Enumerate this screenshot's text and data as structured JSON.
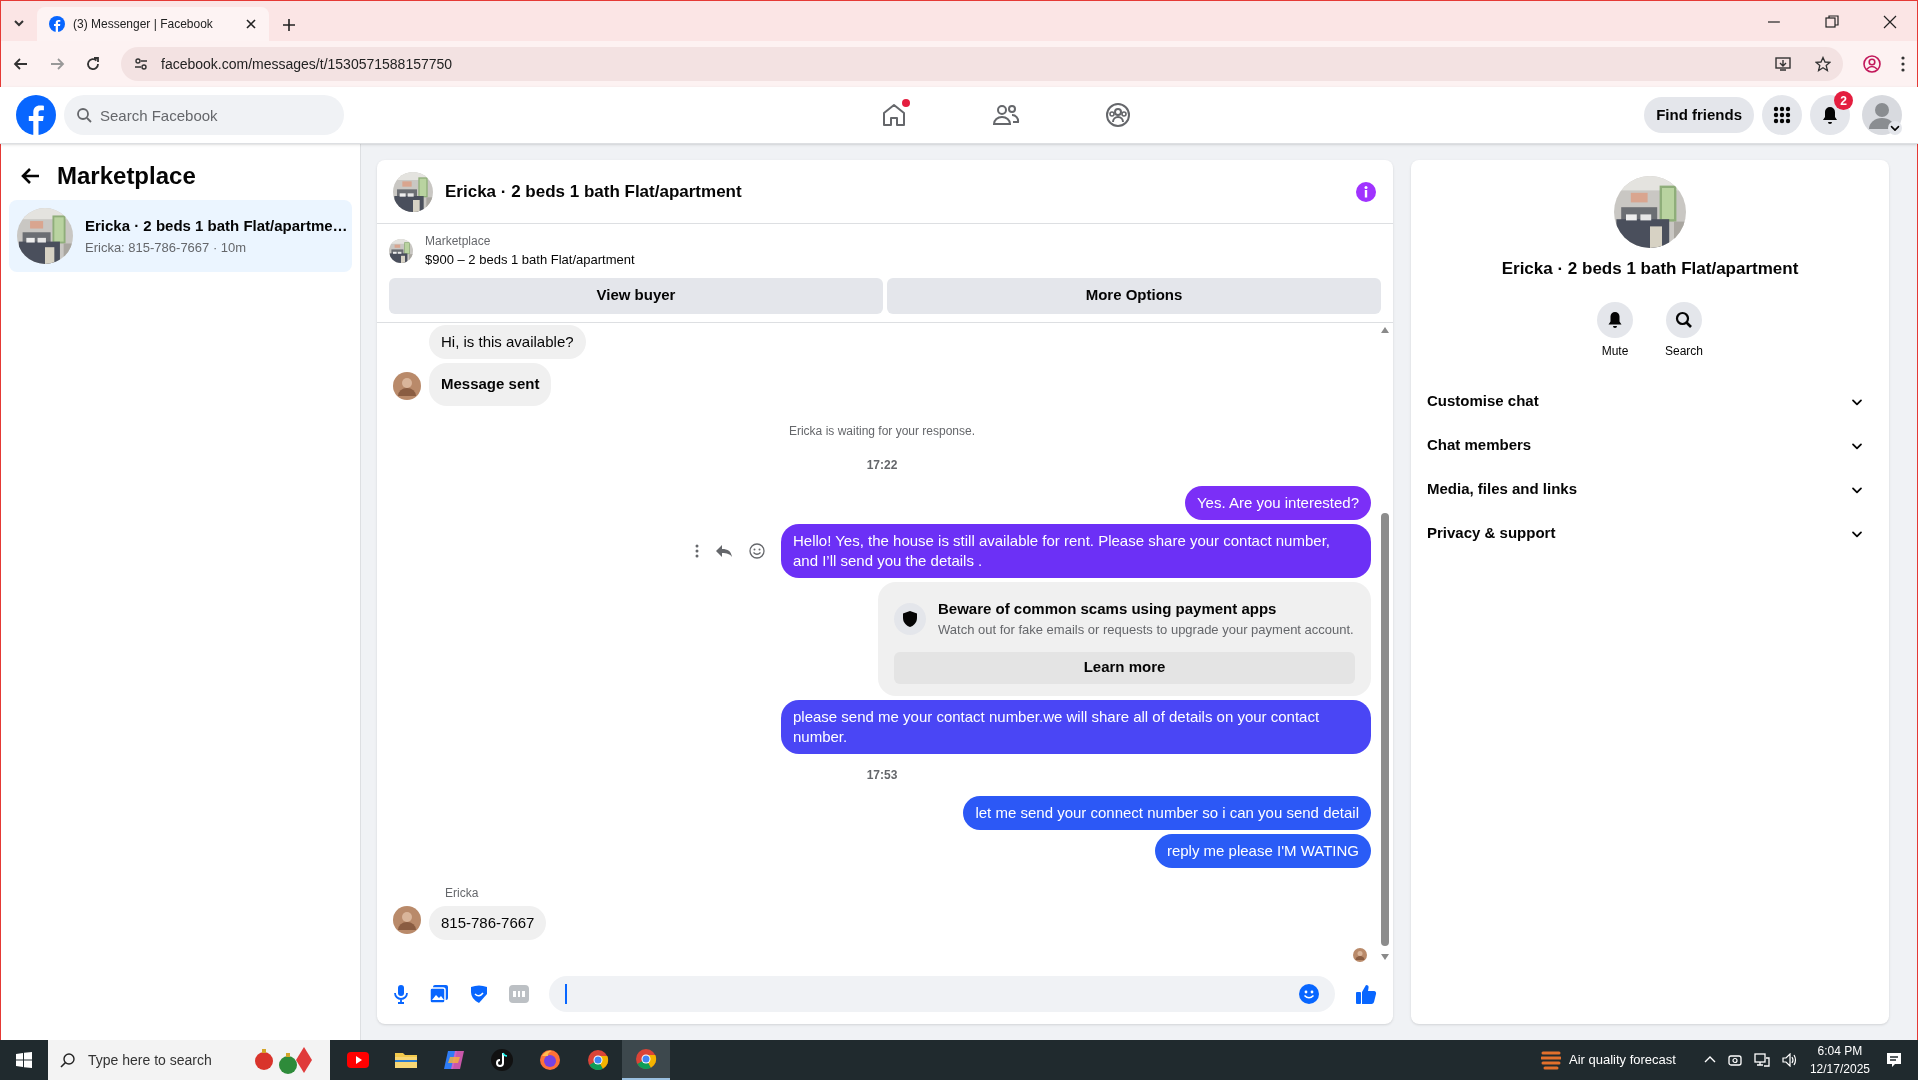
{
  "browser": {
    "tabs": [
      {
        "title": "(3) Messenger | Facebook",
        "selected": true
      }
    ],
    "url": "facebook.com/messages/t/1530571588157750"
  },
  "header": {
    "search_placeholder": "Search Facebook",
    "nav": [
      {
        "kind": "home",
        "dot": true
      },
      {
        "kind": "friends",
        "dot": false
      },
      {
        "kind": "groups",
        "dot": false
      }
    ],
    "find_friends": "Find friends",
    "notification_count": "2"
  },
  "left": {
    "title": "Marketplace",
    "conversations": [
      {
        "title": "Ericka · 2 beds 1 bath Flat/apartme…",
        "subtitle": "Ericka: 815-786-7667 · 10m",
        "selected": true
      }
    ]
  },
  "chat": {
    "title": "Ericka · 2 beds 1 bath Flat/apartment",
    "listing": {
      "source": "Marketplace",
      "text": "$900 – 2 beds 1 bath Flat/apartment"
    },
    "buttons": [
      "View buyer",
      "More Options"
    ],
    "messages": [
      {
        "kind": "incoming",
        "text": "Hi, is this available?",
        "bold": false,
        "avatar": false
      },
      {
        "kind": "incoming",
        "text": "Message sent",
        "bold": true,
        "avatar": true
      },
      {
        "kind": "notice",
        "text": "Ericka is waiting for your response."
      },
      {
        "kind": "time",
        "text": "17:22"
      },
      {
        "kind": "outgoing",
        "text": "Yes. Are you interested?",
        "color": "#7b2ff7",
        "actions": false
      },
      {
        "kind": "outgoing",
        "text": "Hello! Yes, the house is still available for rent. Please share your contact number, and I’ll send you the details .",
        "color": "#6c30f6",
        "actions": true
      },
      {
        "kind": "warning",
        "title": "Beware of common scams using payment apps",
        "text": "Watch out for fake emails or requests to upgrade your payment account.",
        "button": "Learn more"
      },
      {
        "kind": "outgoing",
        "text": "please send me your contact number.we will share all of details on your contact number.",
        "color": "#4a46f5",
        "actions": false
      },
      {
        "kind": "time",
        "text": "17:53"
      },
      {
        "kind": "outgoing",
        "text": "let me send your connect number so i can you send detail",
        "color": "#2c58f6",
        "actions": false
      },
      {
        "kind": "outgoing",
        "text": "reply me please I'M WATING",
        "color": "#2a5cf6",
        "actions": false
      },
      {
        "kind": "sender",
        "text": "Ericka"
      },
      {
        "kind": "incoming",
        "text": "815-786-7667",
        "bold": false,
        "avatar": true
      }
    ]
  },
  "details": {
    "title": "Ericka · 2 beds 1 bath Flat/apartment",
    "actions": [
      {
        "kind": "mute",
        "label": "Mute"
      },
      {
        "kind": "search",
        "label": "Search"
      }
    ],
    "sections": [
      {
        "label": "Customise chat",
        "expanded": false
      },
      {
        "label": "Chat members",
        "expanded": false
      },
      {
        "label": "Media, files and links",
        "expanded": false
      },
      {
        "label": "Privacy & support",
        "expanded": false
      }
    ]
  },
  "taskbar": {
    "search_placeholder": "Type here to search",
    "apps": [
      {
        "kind": "youtube",
        "active": false
      },
      {
        "kind": "files",
        "active": false
      },
      {
        "kind": "copilot",
        "active": false
      },
      {
        "kind": "tiktok",
        "active": false
      },
      {
        "kind": "firefox",
        "active": false
      },
      {
        "kind": "chrome",
        "active": false
      },
      {
        "kind": "chrome",
        "active": true
      }
    ],
    "weather": "Air quality forecast",
    "time": "6:04 PM",
    "date": "12/17/2025"
  }
}
